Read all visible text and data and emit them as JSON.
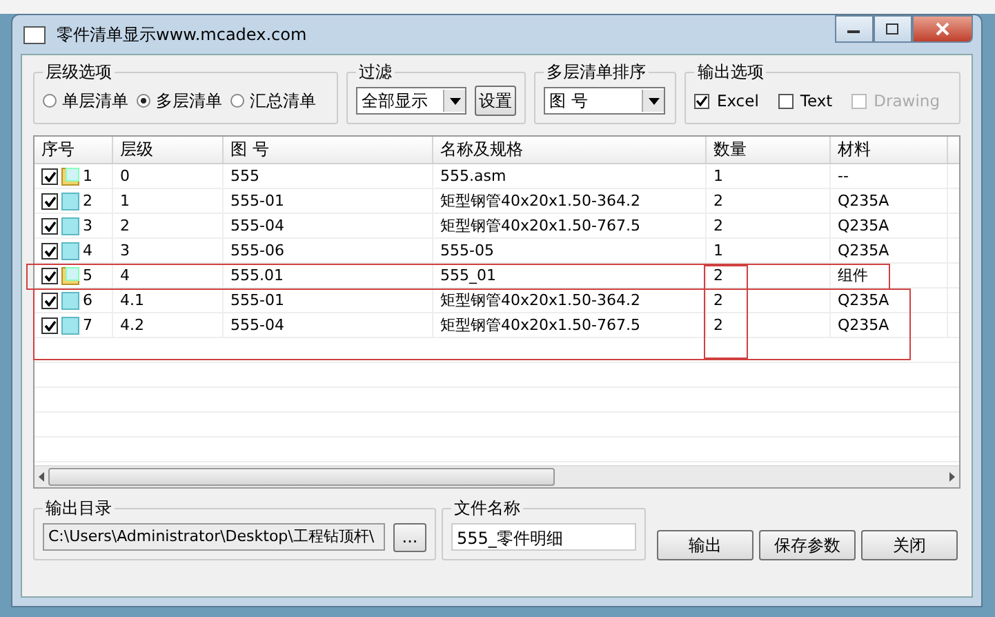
{
  "window": {
    "title": "零件清单显示www.mcadex.com"
  },
  "level_options": {
    "title": "层级选项",
    "options": [
      {
        "label": "单层清单",
        "selected": false
      },
      {
        "label": "多层清单",
        "selected": true
      },
      {
        "label": "汇总清单",
        "selected": false
      }
    ]
  },
  "filter": {
    "title": "过滤",
    "value": "全部显示",
    "button": "设置"
  },
  "sort": {
    "title": "多层清单排序",
    "value": "图 号"
  },
  "output_options": {
    "title": "输出选项",
    "items": [
      {
        "label": "Excel",
        "checked": true,
        "disabled": false
      },
      {
        "label": "Text",
        "checked": false,
        "disabled": false
      },
      {
        "label": "Drawing",
        "checked": false,
        "disabled": true
      }
    ]
  },
  "table": {
    "columns": [
      "序号",
      "层级",
      "图 号",
      "名称及规格",
      "数量",
      "材料"
    ],
    "rows": [
      {
        "checked": true,
        "kind": "assembly",
        "cells": [
          "1",
          "0",
          "555",
          "555.asm",
          "1",
          "--"
        ]
      },
      {
        "checked": true,
        "kind": "part",
        "cells": [
          "2",
          "1",
          "555-01",
          "矩型钢管40x20x1.50-364.2",
          "2",
          "Q235A"
        ]
      },
      {
        "checked": true,
        "kind": "part",
        "cells": [
          "3",
          "2",
          "555-04",
          "矩型钢管40x20x1.50-767.5",
          "2",
          "Q235A"
        ]
      },
      {
        "checked": true,
        "kind": "part",
        "cells": [
          "4",
          "3",
          "555-06",
          "555-05",
          "1",
          "Q235A"
        ]
      },
      {
        "checked": true,
        "kind": "assembly",
        "cells": [
          "5",
          "4",
          "555.01",
          "555_01",
          "2",
          "组件"
        ]
      },
      {
        "checked": true,
        "kind": "part",
        "cells": [
          "6",
          "4.1",
          "555-01",
          "矩型钢管40x20x1.50-364.2",
          "2",
          "Q235A"
        ]
      },
      {
        "checked": true,
        "kind": "part",
        "cells": [
          "7",
          "4.2",
          "555-04",
          "矩型钢管40x20x1.50-767.5",
          "2",
          "Q235A"
        ]
      }
    ]
  },
  "output_dir": {
    "title": "输出目录",
    "value": "C:\\Users\\Administrator\\Desktop\\工程钻顶杆\\",
    "browse": "..."
  },
  "file_name": {
    "title": "文件名称",
    "value": "555_零件明细"
  },
  "buttons": [
    "输出",
    "保存参数",
    "关闭"
  ]
}
